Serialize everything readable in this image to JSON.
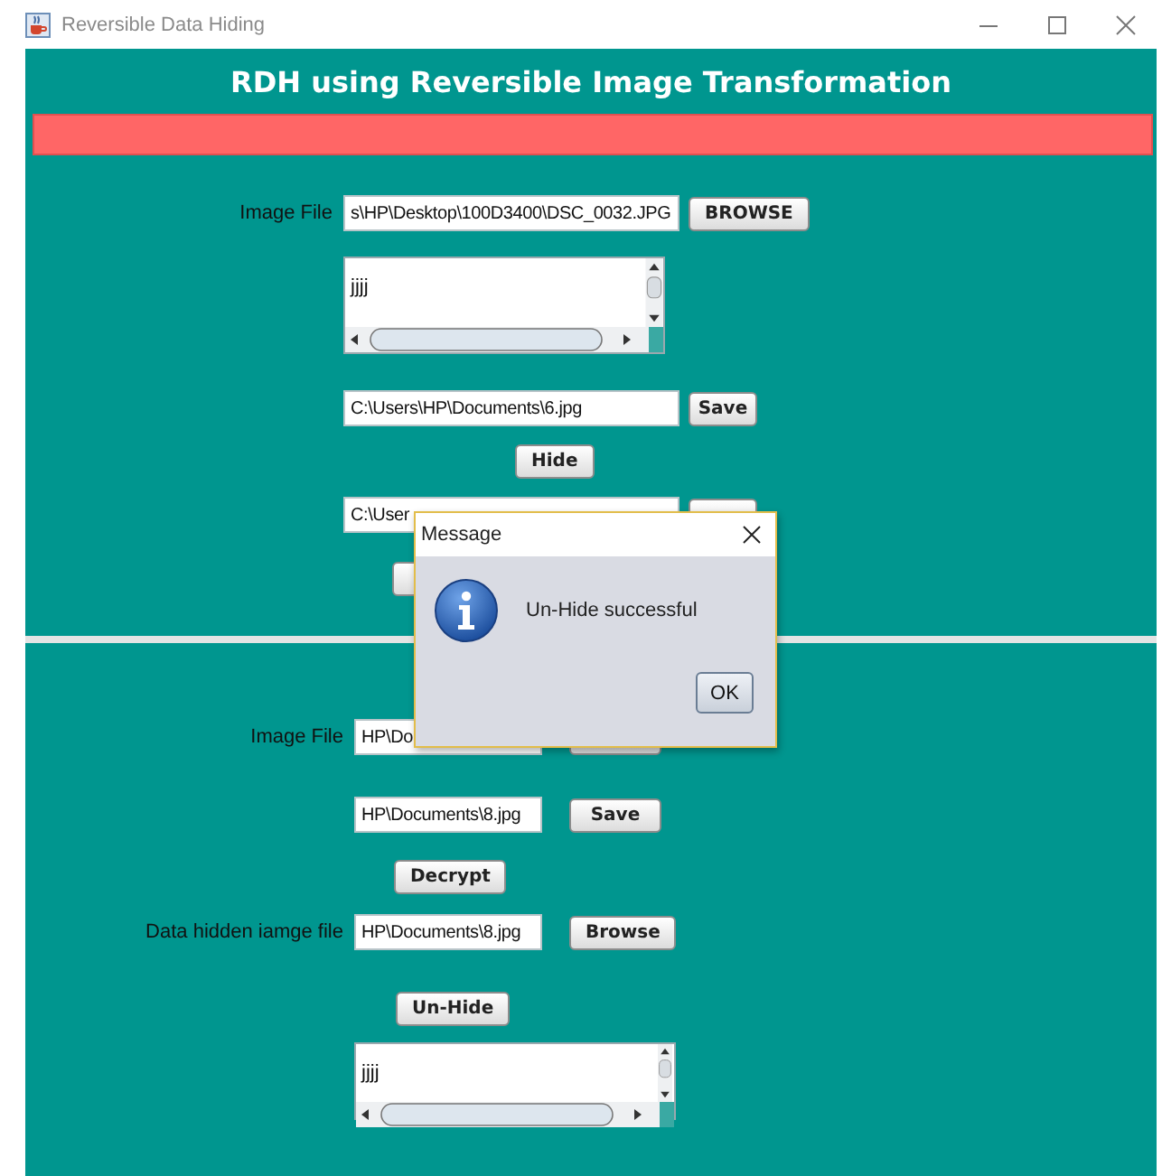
{
  "window": {
    "title": "Reversible Data Hiding"
  },
  "header": {
    "title": "RDH using Reversible Image Transformation"
  },
  "hide_panel": {
    "image_file": {
      "label": "Image File",
      "value": "s\\HP\\Desktop\\100D3400\\DSC_0032.JPG",
      "button": "BROWSE"
    },
    "message": {
      "value": "jjjj"
    },
    "output_file": {
      "value": "C:\\Users\\HP\\Documents\\6.jpg",
      "button": "Save"
    },
    "hide_button": "Hide",
    "stego_file": {
      "value": "C:\\User"
    }
  },
  "unhide_panel": {
    "image_file": {
      "label": "Image File",
      "value": "HP\\Do"
    },
    "output_file": {
      "value": "HP\\Documents\\8.jpg",
      "button": "Save"
    },
    "decrypt_button": "Decrypt",
    "data_hidden_file": {
      "label": "Data hidden iamge file",
      "value": "HP\\Documents\\8.jpg",
      "button": "Browse"
    },
    "unhide_button": "Un-Hide",
    "message": {
      "value": "jjjj"
    }
  },
  "dialog": {
    "title": "Message",
    "text": "Un-Hide successful",
    "button": "OK"
  }
}
